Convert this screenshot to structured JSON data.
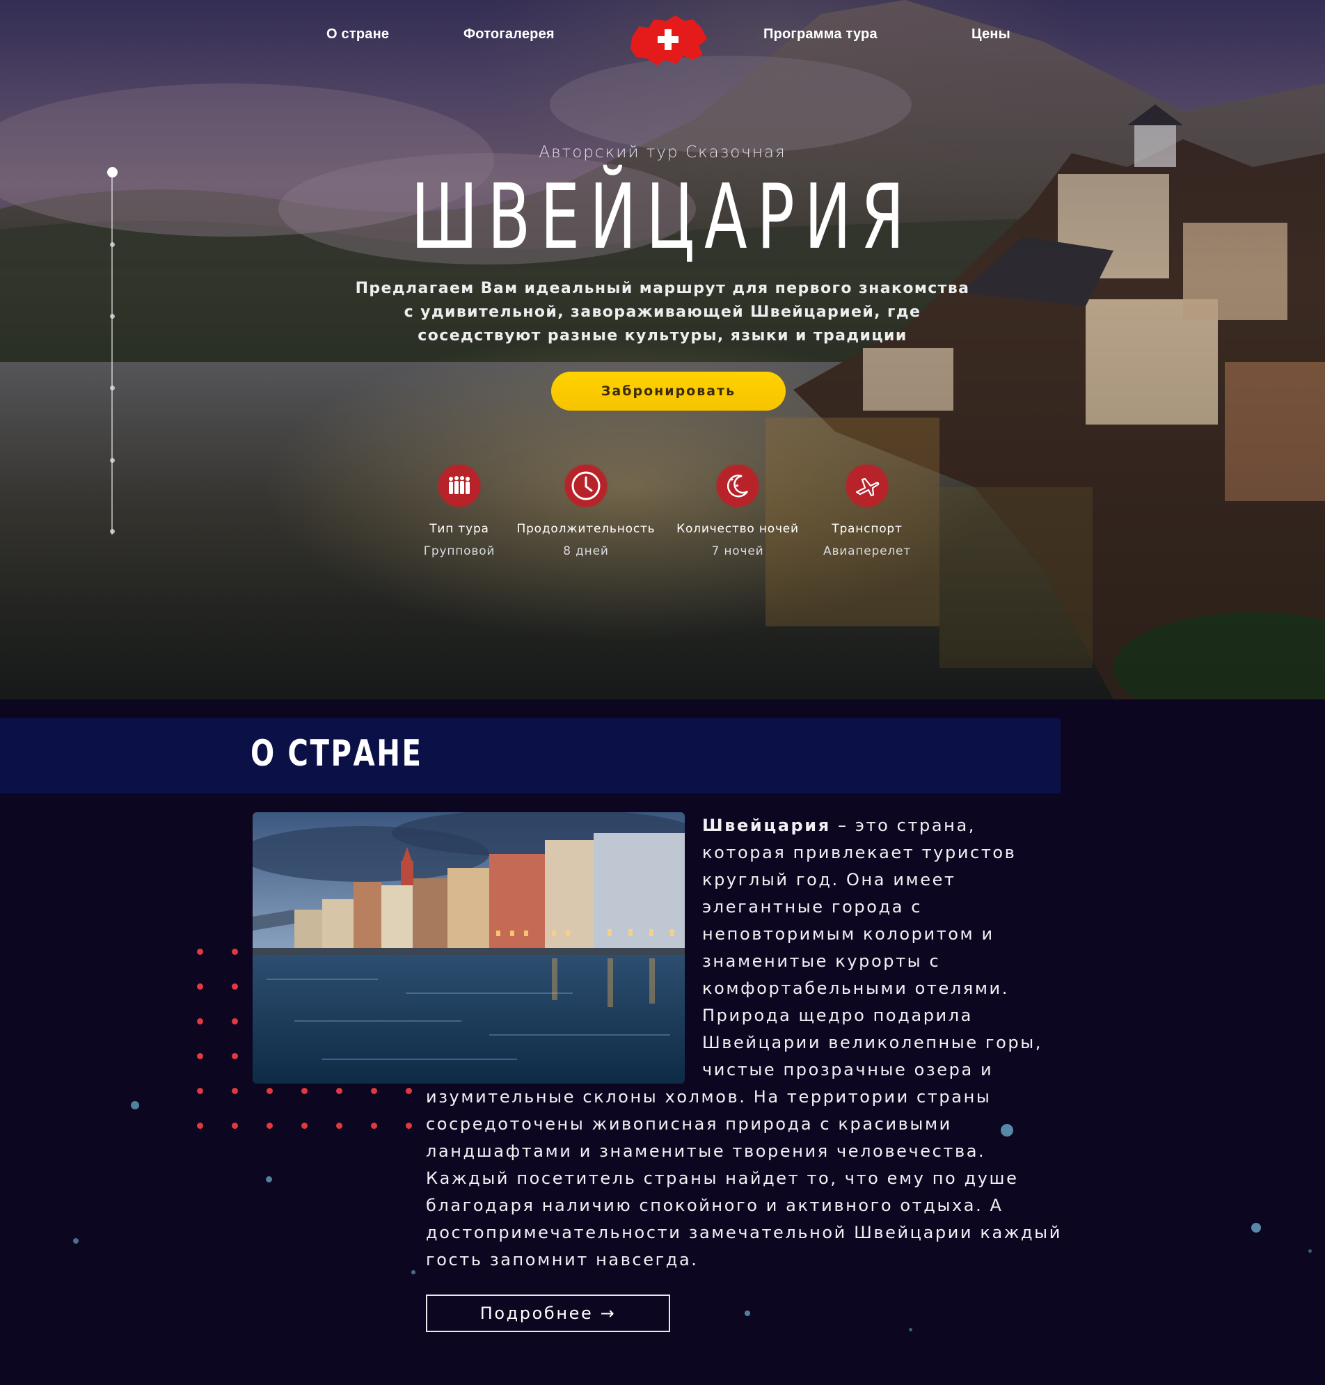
{
  "nav": {
    "items": [
      "О стране",
      "Фотогалерея",
      "Программа тура",
      "Цены"
    ],
    "logo": "swiss-map-logo"
  },
  "hero": {
    "subtitle": "Авторский тур Сказочная",
    "title": "ШВЕЙЦАРИЯ",
    "lead_lines": [
      "Предлагаем Вам идеальный маршрут для первого знакомства",
      "с удивительной, завораживающей Швейцарией, где",
      "соседствуют разные культуры, языки и традиции"
    ],
    "book_button": "Забронировать",
    "features": [
      {
        "icon": "group-icon",
        "label": "Тип тура",
        "value": "Групповой"
      },
      {
        "icon": "clock-icon",
        "label": "Продолжительность",
        "value": "8 дней"
      },
      {
        "icon": "moon-icon",
        "label": "Количество ночей",
        "value": "7 ночей"
      },
      {
        "icon": "plane-icon",
        "label": "Транспорт",
        "value": "Авиаперелет"
      }
    ]
  },
  "about": {
    "heading": "О СТРАНЕ",
    "text_bold": "Швейцария",
    "text_side_lines": [
      " – это страна,",
      "которая привлекает туристов",
      "круглый год. Она имеет",
      "элегантные города с",
      "неповторимым колоритом и",
      "знаменитые курорты с",
      "комфортабельными отелями.",
      "Природа щедро подарила",
      "Швейцарии великолепные горы,",
      "чистые прозрачные озера и"
    ],
    "text_wide_lines": [
      "изумительные склоны холмов. На территории страны",
      "сосредоточены живописная природа с красивыми",
      "ландшафтами и знаменитые творения человечества.",
      "Каждый посетитель страны найдет то, что ему по душе",
      "благодаря наличию спокойного и активного отдыха. А",
      "достопримечательности замечательной Швейцарии каждый",
      "гость запомнит навсегда."
    ],
    "more_button": "Подробнее →"
  },
  "colors": {
    "accent_yellow": "#ffd200",
    "accent_red": "#b8232a",
    "band_navy": "#0b1046",
    "page_bg": "#0d0620"
  }
}
